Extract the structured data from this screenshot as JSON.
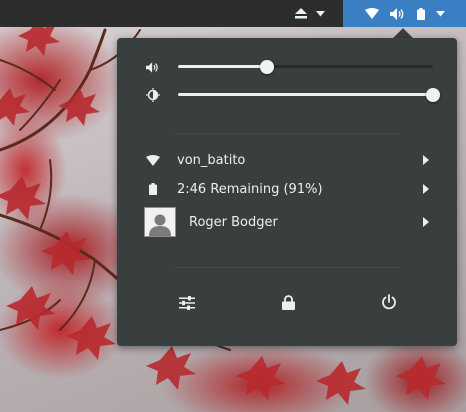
{
  "topbar": {
    "eject_icon": "eject-icon",
    "status_icons": [
      "wifi-icon",
      "volume-icon",
      "battery-icon",
      "chevron-down-icon"
    ]
  },
  "menu": {
    "volume": {
      "icon": "volume-icon",
      "level": 0.35
    },
    "brightness": {
      "icon": "brightness-icon",
      "level": 1.0
    },
    "network": {
      "icon": "wifi-icon",
      "label": "von_batito"
    },
    "battery": {
      "icon": "battery-icon",
      "label": "2:46 Remaining (91%)"
    },
    "user": {
      "icon": "avatar",
      "label": "Roger Bodger"
    },
    "actions": [
      "settings-icon",
      "lock-icon",
      "power-icon"
    ]
  },
  "colors": {
    "topbar": "#2d2d2d",
    "status_highlight": "#3a7fc4",
    "menu_bg": "#393f3f",
    "text": "#eeeeec"
  }
}
